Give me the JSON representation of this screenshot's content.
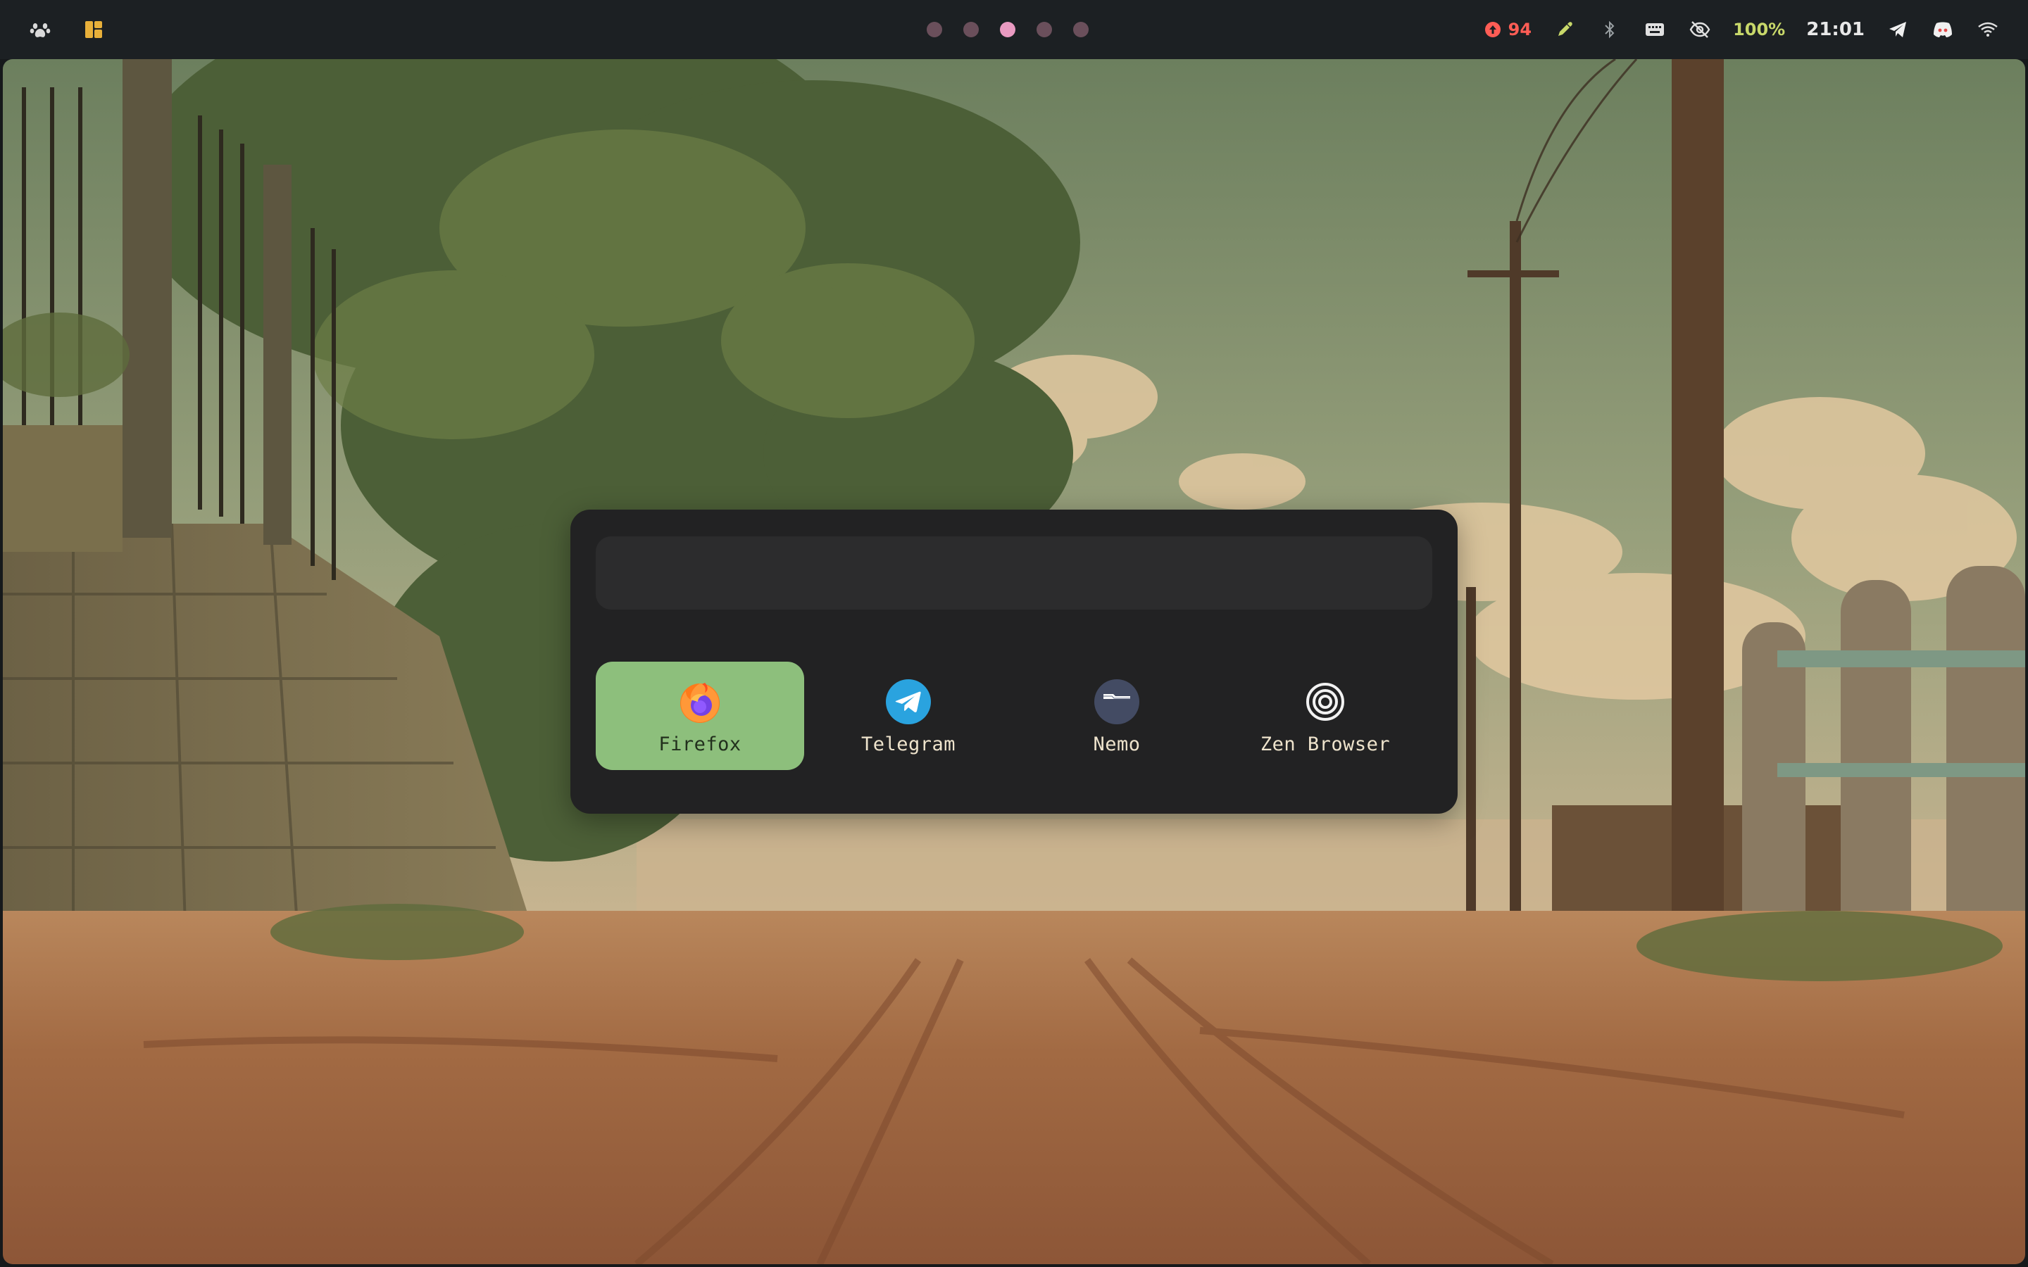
{
  "topbar": {
    "left_icons": [
      "paw-icon",
      "dashboard-layout-icon"
    ],
    "workspaces": {
      "count": 5,
      "active_index": 2
    },
    "tray": {
      "updates_count": "94",
      "battery": "100%",
      "clock": "21:01",
      "icons": [
        "color-picker-icon",
        "bluetooth-icon",
        "keyboard-icon",
        "eye-off-icon",
        "telegram-icon",
        "discord-icon",
        "wifi-icon"
      ]
    },
    "colors": {
      "bar": "#1c2023",
      "workspace_active": "#e99ac1",
      "workspace_inactive": "#6a4f5b",
      "updates": "#ff5d55",
      "battery": "#c8d86a"
    }
  },
  "launcher": {
    "search_value": "",
    "search_placeholder": "",
    "apps": [
      {
        "label": "Firefox",
        "icon": "firefox-icon",
        "selected": true
      },
      {
        "label": "Telegram",
        "icon": "telegram-app-icon",
        "selected": false
      },
      {
        "label": "Nemo",
        "icon": "nemo-folder-icon",
        "selected": false
      },
      {
        "label": "Zen Browser",
        "icon": "zen-browser-icon",
        "selected": false
      }
    ],
    "colors": {
      "panel": "#222223",
      "search": "#2c2c2d",
      "selected": "#8dbf7c"
    }
  },
  "wallpaper": {
    "description_icon": "wallpaper-image"
  }
}
